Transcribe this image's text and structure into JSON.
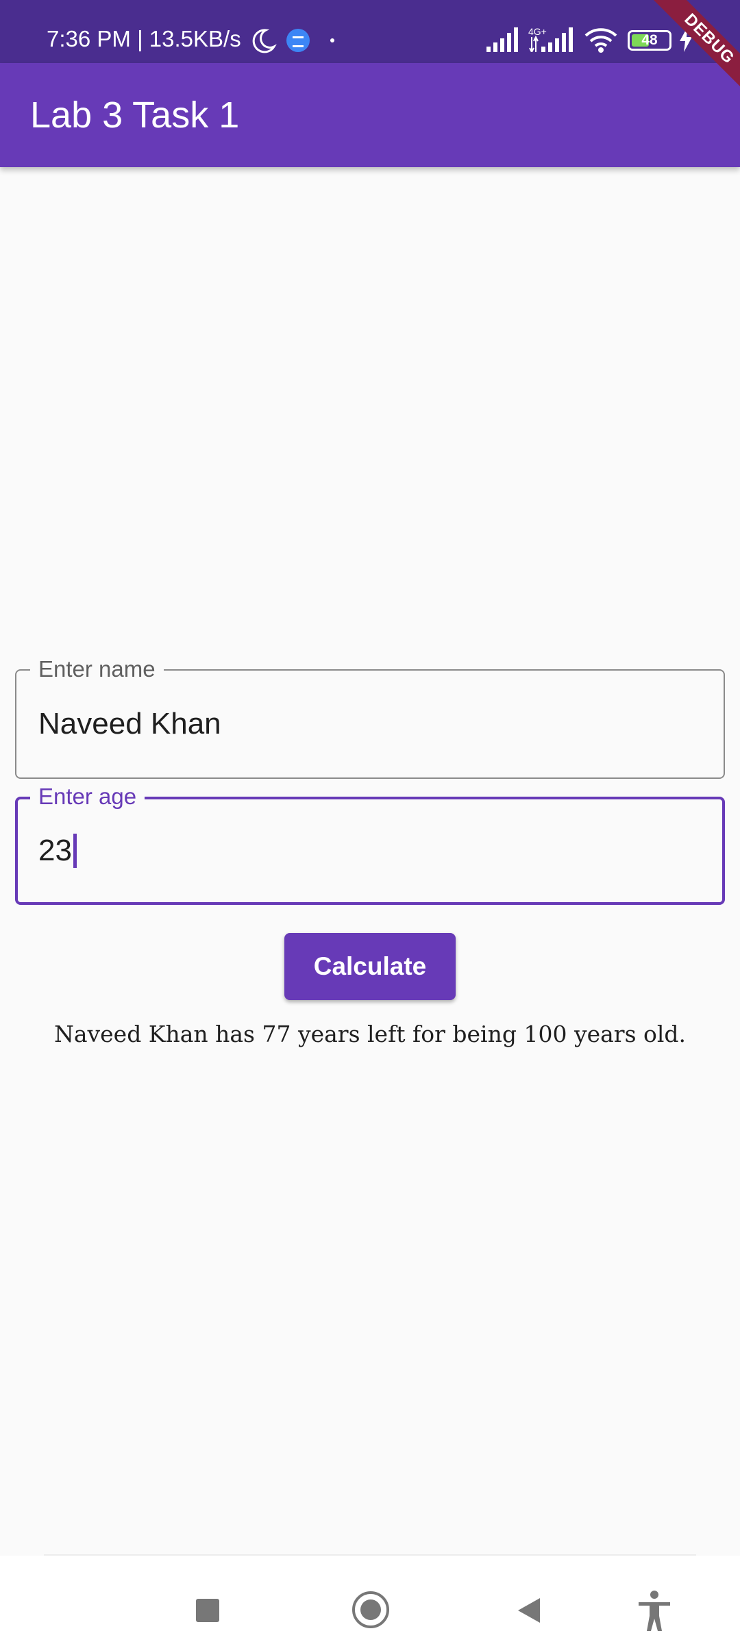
{
  "status_bar": {
    "time_speed": "7:36 PM | 13.5KB/s",
    "network_label": "4G+",
    "battery_level": "48",
    "battery_fraction": 0.48,
    "icons": [
      "moon-icon",
      "message-icon",
      "signal-icon",
      "wifi-icon",
      "battery-icon",
      "charging-bolt-icon"
    ]
  },
  "debug_banner": "DEBUG",
  "app_bar": {
    "title": "Lab 3 Task 1"
  },
  "form": {
    "name_field": {
      "label": "Enter name",
      "value": "Naveed Khan"
    },
    "age_field": {
      "label": "Enter age",
      "value": "23"
    },
    "calculate_label": "Calculate"
  },
  "result": "Naveed Khan has 77 years left for being 100 years old.",
  "nav_bar": {
    "icons": [
      "recents-icon",
      "home-icon",
      "back-icon",
      "accessibility-icon"
    ]
  },
  "colors": {
    "primary": "#673ab7",
    "status_bar": "#4a2d8f",
    "debug": "#8b1e3f"
  }
}
